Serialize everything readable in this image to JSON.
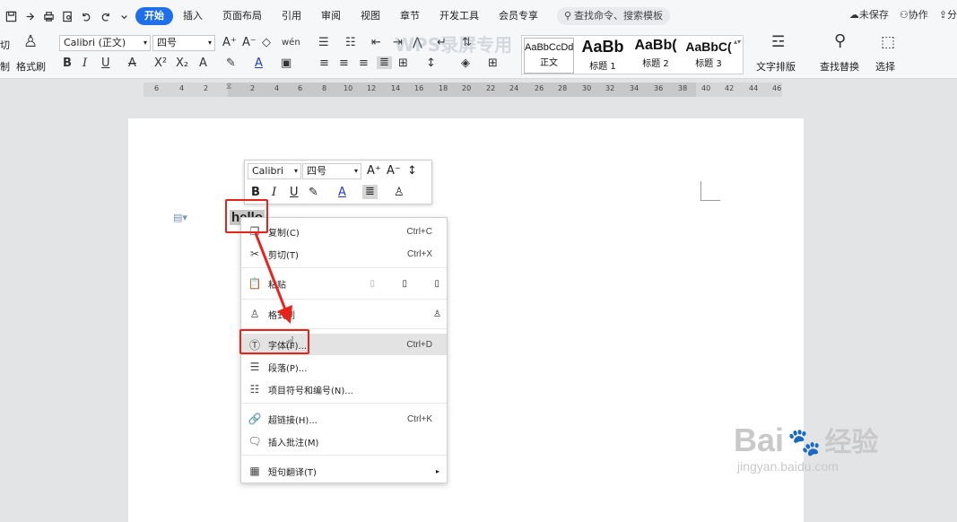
{
  "menubar": {
    "tabs": [
      "开始",
      "插入",
      "页面布局",
      "引用",
      "审阅",
      "视图",
      "章节",
      "开发工具",
      "会员专享"
    ],
    "active_tab": "开始",
    "search_label": "查找命令、搜索模板",
    "unsaved": "未保存",
    "collab": "协作",
    "share": "分"
  },
  "ribbon": {
    "cut": "切",
    "cut_sub": "制",
    "format_painter": "格式刷",
    "font_name": "Calibri (正文)",
    "font_size": "四号",
    "styles": [
      {
        "preview": "AaBbCcDd",
        "label": "正文"
      },
      {
        "preview": "AaBb",
        "label": "标题 1"
      },
      {
        "preview": "AaBb(",
        "label": "标题 2"
      },
      {
        "preview": "AaBbC(",
        "label": "标题 3"
      }
    ],
    "text_layout": "文字排版",
    "find_replace": "查找替换",
    "select": "选择",
    "watermark": "WPS录屏专用"
  },
  "ruler": {
    "ticks": [
      "6",
      "4",
      "2",
      "2",
      "4",
      "6",
      "8",
      "10",
      "12",
      "14",
      "16",
      "18",
      "20",
      "22",
      "24",
      "26",
      "28",
      "30",
      "32",
      "34",
      "36",
      "38",
      "40",
      "42",
      "44",
      "46"
    ]
  },
  "mini_toolbar": {
    "font": "Calibri",
    "size": "四号"
  },
  "document": {
    "text": "hello"
  },
  "context_menu": {
    "items": [
      {
        "label": "复制(C)",
        "shortcut": "Ctrl+C",
        "icon": "copy-icon"
      },
      {
        "label": "剪切(T)",
        "shortcut": "Ctrl+X",
        "icon": "scissors-icon"
      },
      {
        "label": "粘贴",
        "shortcut": "",
        "icon": "paste-icon"
      },
      {
        "label": "格式刷",
        "shortcut": "",
        "icon": "brush-icon"
      },
      {
        "label": "字体(F)...",
        "shortcut": "Ctrl+D",
        "icon": "font-icon"
      },
      {
        "label": "段落(P)...",
        "shortcut": "",
        "icon": "paragraph-icon"
      },
      {
        "label": "项目符号和编号(N)...",
        "shortcut": "",
        "icon": "list-icon"
      },
      {
        "label": "超链接(H)...",
        "shortcut": "Ctrl+K",
        "icon": "link-icon"
      },
      {
        "label": "插入批注(M)",
        "shortcut": "",
        "icon": "comment-icon"
      },
      {
        "label": "短句翻译(T)",
        "shortcut": "",
        "icon": "translate-icon"
      }
    ]
  },
  "watermark": {
    "brand": "Bai",
    "brand2": "经验",
    "url": "jingyan.baidu.com"
  },
  "colors": {
    "accent": "#1f6feb",
    "highlight_box": "#e8231c"
  }
}
